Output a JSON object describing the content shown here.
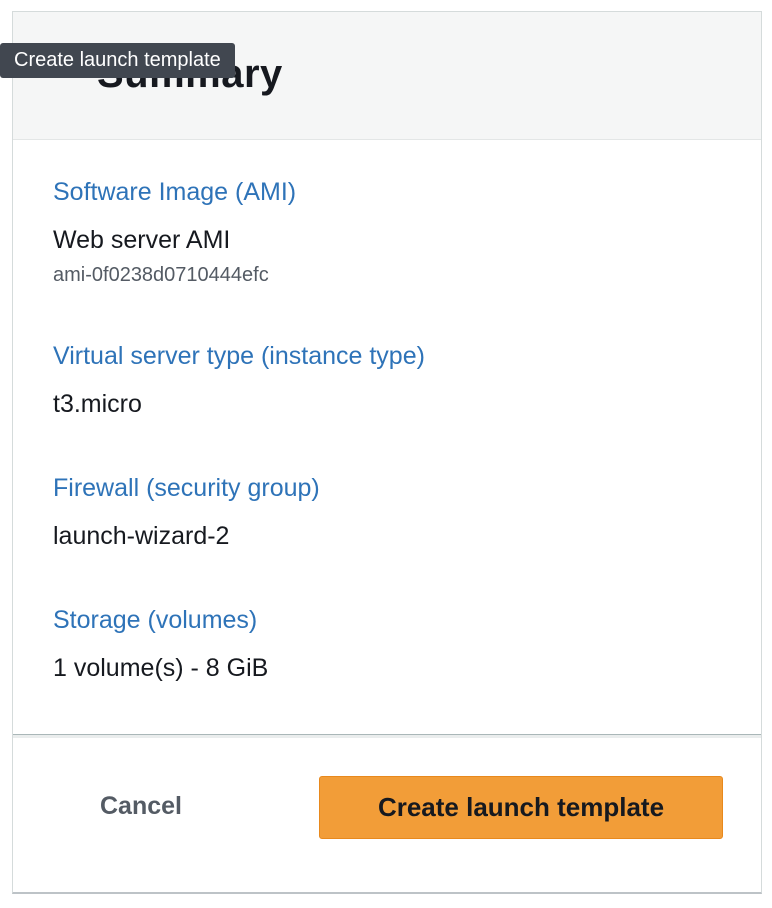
{
  "tooltip": {
    "text": "Create launch template"
  },
  "summary": {
    "title": "Summary",
    "fields": [
      {
        "label": "Software Image (AMI)",
        "value": "Web server AMI",
        "sub": "ami-0f0238d0710444efc"
      },
      {
        "label": "Virtual server type (instance type)",
        "value": "t3.micro"
      },
      {
        "label": "Firewall (security group)",
        "value": "launch-wizard-2"
      },
      {
        "label": "Storage (volumes)",
        "value": "1 volume(s) - 8 GiB"
      }
    ]
  },
  "footer": {
    "cancel_label": "Cancel",
    "create_label": "Create launch template"
  },
  "colors": {
    "link_blue": "#2e73b8",
    "primary_orange": "#f29d38",
    "tooltip_bg": "#414750",
    "text_dark": "#16191f",
    "text_muted": "#545b64"
  }
}
